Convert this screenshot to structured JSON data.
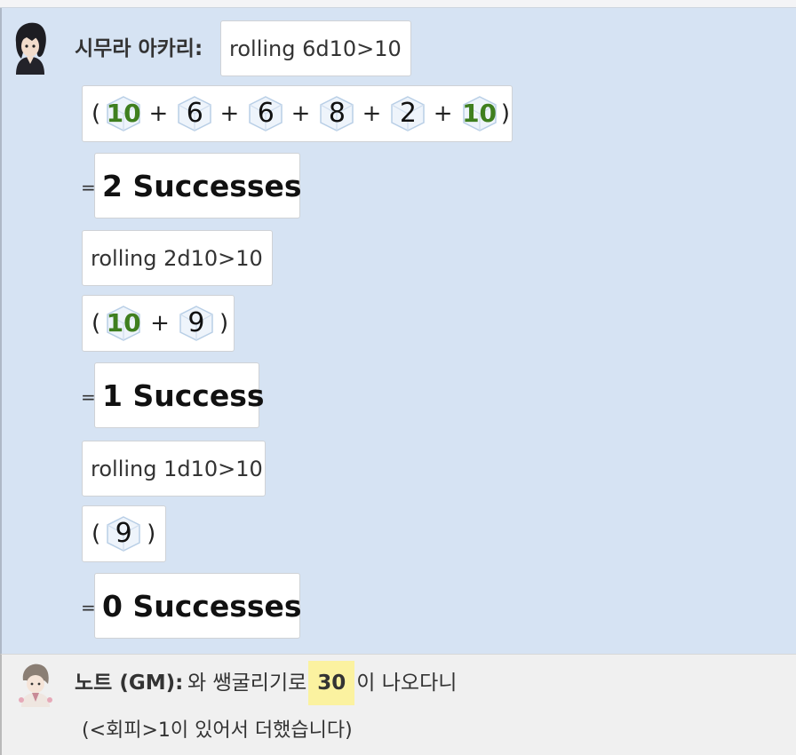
{
  "messages": [
    {
      "speaker": "시무라 아카리:",
      "rolls": [
        {
          "command": "rolling 6d10>10",
          "open_paren": "(",
          "close_paren": ")",
          "plus": "+",
          "dice": [
            "10",
            "6",
            "6",
            "8",
            "2",
            "10"
          ],
          "equals": "=",
          "result": "2 Successes"
        },
        {
          "command": "rolling 2d10>10",
          "open_paren": "(",
          "close_paren": ")",
          "plus": "+",
          "dice": [
            "10",
            "9"
          ],
          "equals": "=",
          "result": "1 Success"
        },
        {
          "command": "rolling 1d10>10",
          "open_paren": "(",
          "close_paren": ")",
          "dice": [
            "9"
          ],
          "equals": "=",
          "result": "0 Successes"
        }
      ]
    },
    {
      "speaker": "노트 (GM):",
      "text_before": "와 쌩굴리기로",
      "highlight": "30",
      "text_after": "이 나오다니",
      "line2": "(<회피>1이 있어서 더했습니다)"
    }
  ],
  "colors": {
    "player_message_bg": "#d6e3f3",
    "gm_message_bg": "#f0f0f0",
    "critical_die_text": "#3f7f1f",
    "die_outline": "#b9cfe6",
    "highlight_bg": "#fbf2a0"
  },
  "icons": {
    "die": "d10-hex-die-icon"
  }
}
